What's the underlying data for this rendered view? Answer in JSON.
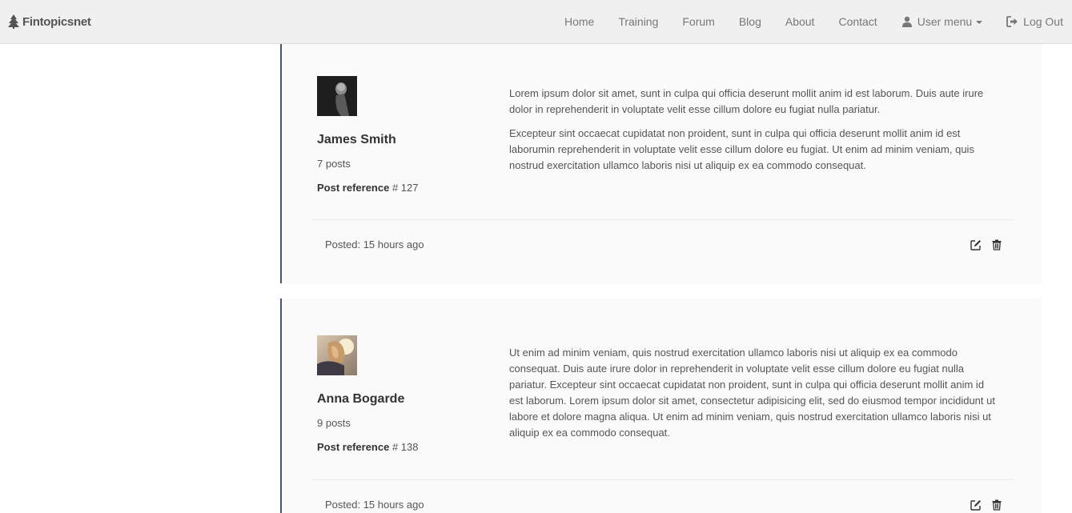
{
  "navbar": {
    "brand": "Fintopicsnet",
    "links": [
      {
        "label": "Home"
      },
      {
        "label": "Training"
      },
      {
        "label": "Forum"
      },
      {
        "label": "Blog"
      },
      {
        "label": "About"
      },
      {
        "label": "Contact"
      }
    ],
    "user_menu": {
      "label": "User menu",
      "icon": "user-icon"
    },
    "logout": {
      "label": "Log Out",
      "icon": "log-out-icon"
    }
  },
  "posts": [
    {
      "author": "James Smith",
      "posts_count": "7 posts",
      "ref_label": "Post reference",
      "ref_value": "# 127",
      "paragraphs": [
        "Lorem ipsum dolor sit amet, sunt in culpa qui officia deserunt mollit anim id est laborum. Duis aute irure dolor in reprehenderit in voluptate velit esse cillum dolore eu fugiat nulla pariatur.",
        "Excepteur sint occaecat cupidatat non proident, sunt in culpa qui officia deserunt mollit anim id est laborumin reprehenderit in voluptate velit esse cillum dolore eu fugiat. Ut enim ad minim veniam, quis nostrud exercitation ullamco laboris nisi ut aliquip ex ea commodo consequat."
      ],
      "posted": "Posted: 15 hours ago",
      "avatar": "dark-portrait-avatar"
    },
    {
      "author": "Anna Bogarde",
      "posts_count": "9 posts",
      "ref_label": "Post reference",
      "ref_value": "# 138",
      "paragraphs": [
        "Ut enim ad minim veniam, quis nostrud exercitation ullamco laboris nisi ut aliquip ex ea commodo consequat. Duis aute irure dolor in reprehenderit in voluptate velit esse cillum dolore eu fugiat nulla pariatur. Excepteur sint occaecat cupidatat non proident, sunt in culpa qui officia deserunt mollit anim id est laborum. Lorem ipsum dolor sit amet, consectetur adipisicing elit, sed do eiusmod tempor incididunt ut labore et dolore magna aliqua. Ut enim ad minim veniam, quis nostrud exercitation ullamco laboris nisi ut aliquip ex ea commodo consequat."
      ],
      "posted": "Posted: 15 hours ago",
      "avatar": "sunlit-hair-portrait-avatar"
    }
  ],
  "colors": {
    "navbar_bg": "#f0f0f0",
    "card_bg": "#fafafa",
    "card_border": "#4a5570",
    "text": "#555555",
    "nav_text": "#777777"
  }
}
